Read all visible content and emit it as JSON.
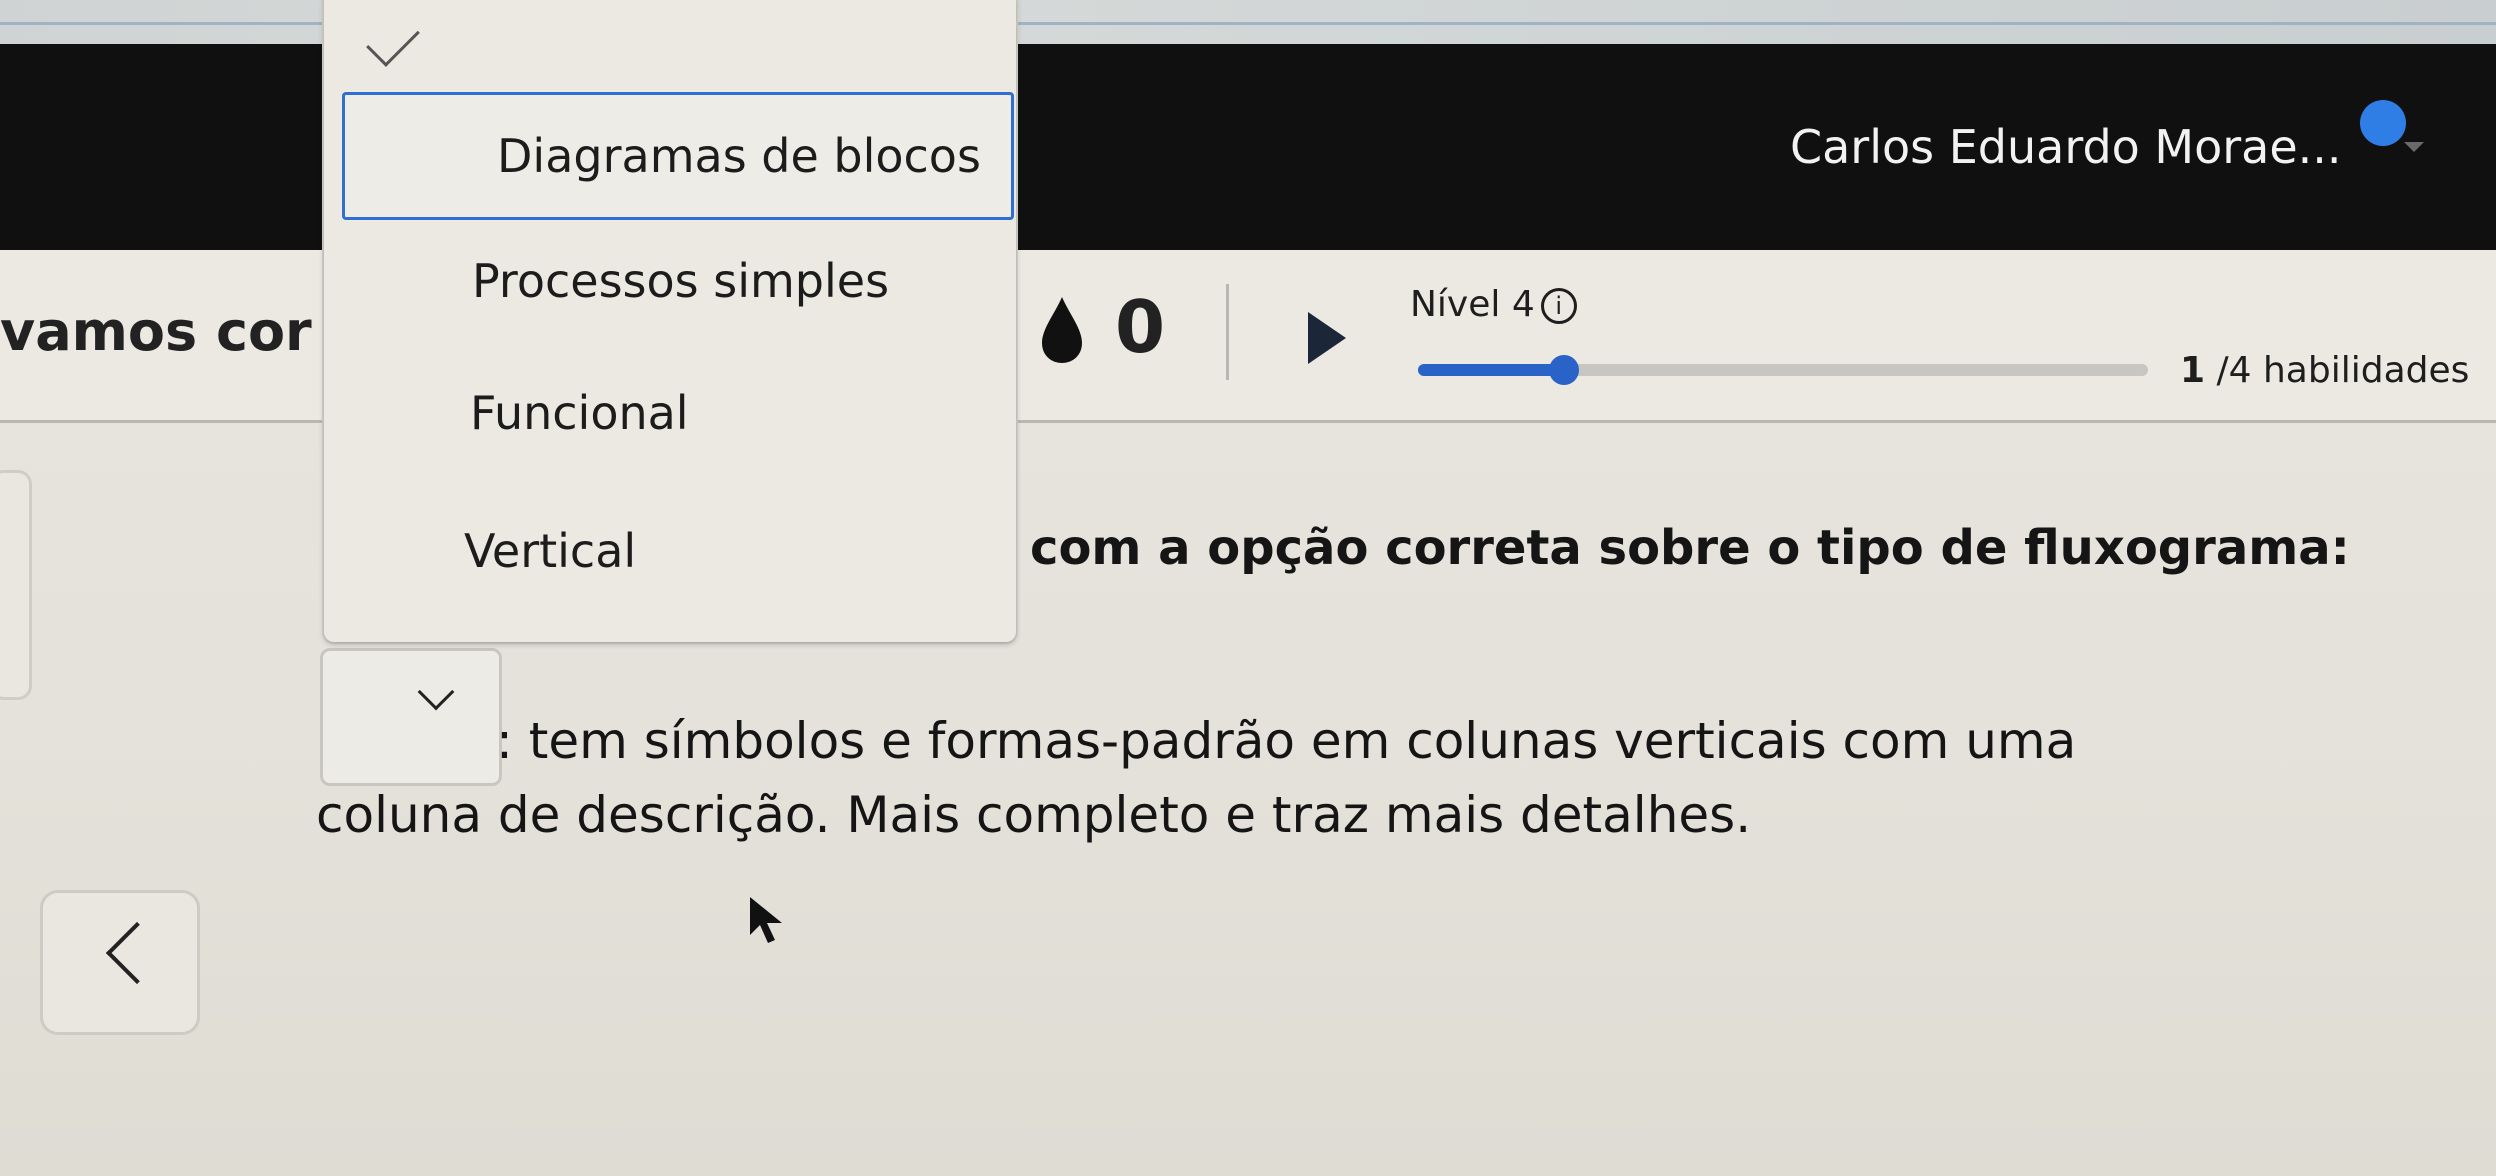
{
  "header": {
    "user_name": "Carlos Eduardo Morae...",
    "avatar_color": "#2f7ee6"
  },
  "status": {
    "greeting_fragment": "vamos cor",
    "streak_count": "0",
    "level_label": "Nível 4",
    "info_glyph": "i",
    "progress_fraction": 0.25,
    "skills_done": "1",
    "skills_total_text": " /4 habilidades"
  },
  "dropdown": {
    "selected_check": "✓",
    "options": [
      {
        "label": "Diagramas de blocos",
        "active": true
      },
      {
        "label": "Processos simples",
        "active": false
      },
      {
        "label": "Funcional",
        "active": false
      },
      {
        "label": "Vertical",
        "active": false
      }
    ],
    "focus_color": "#2f6fcf"
  },
  "question": {
    "prompt_visible": "com a opção correta sobre o tipo de fluxograma:",
    "statement_line1": ": tem símbolos e formas-padrão em colunas verticais com uma",
    "statement_line2": "coluna de descrição. Mais completo e traz mais detalhes.",
    "selected_value": ""
  },
  "icons": {
    "streak": "drop-icon",
    "next": "play-icon",
    "info": "info-icon",
    "back": "chevron-left-icon",
    "select": "chevron-down-icon",
    "check": "check-icon"
  },
  "colors": {
    "header_bg": "#101010",
    "progress": "#2a63c7",
    "play": "#1b2738"
  }
}
